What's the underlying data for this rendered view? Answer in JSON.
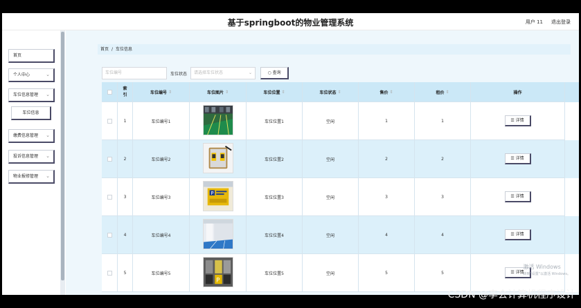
{
  "header": {
    "title": "基于springboot的物业管理系统",
    "user_label": "用户 11",
    "logout_label": "退出登录"
  },
  "sidebar": {
    "items": [
      {
        "label": "首页",
        "chevron": ""
      },
      {
        "label": "个人中心",
        "chevron": "⌄"
      },
      {
        "label": "车位信息管理",
        "chevron": "⌄"
      },
      {
        "label": "车位信息",
        "chevron": ""
      },
      {
        "label": "缴费信息管理",
        "chevron": "⌄"
      },
      {
        "label": "投诉信息管理",
        "chevron": "⌄"
      },
      {
        "label": "物业报修管理",
        "chevron": "⌄"
      }
    ]
  },
  "breadcrumb": {
    "home": "首页",
    "separator": "/",
    "current": "车位信息"
  },
  "search": {
    "number_placeholder": "车位编号",
    "status_label": "车位状态",
    "status_placeholder": "请选择车位状态",
    "query_label": "○ 查询"
  },
  "table": {
    "columns": {
      "index": "索引",
      "number": "车位编号",
      "image": "车位图片",
      "location": "车位位置",
      "status": "车位状态",
      "price": "售价",
      "rent": "租价",
      "action": "操作"
    },
    "sort_icon": "⇕",
    "detail_label": "☰ 详情",
    "rows": [
      {
        "index": "1",
        "number": "车位编号1",
        "location": "车位位置1",
        "status": "空闲",
        "price": "1",
        "rent": "1",
        "image": "parking-green-lot"
      },
      {
        "index": "2",
        "number": "车位编号2",
        "location": "车位位置2",
        "status": "空闲",
        "price": "2",
        "rent": "2",
        "image": "parking-lot-sign"
      },
      {
        "index": "3",
        "number": "车位编号3",
        "location": "车位位置3",
        "status": "空闲",
        "price": "3",
        "rent": "3",
        "image": "parking-yellow-sign"
      },
      {
        "index": "4",
        "number": "车位编号4",
        "location": "车位位置4",
        "status": "空闲",
        "price": "4",
        "rent": "4",
        "image": "parking-garage-blue"
      },
      {
        "index": "5",
        "number": "车位编号5",
        "location": "车位位置5",
        "status": "空闲",
        "price": "5",
        "rent": "5",
        "image": "parking-spaces-cars"
      }
    ]
  },
  "watermark": {
    "line1": "激活 Windows",
    "line2": "转到\"设置\"以激活 Windows。"
  },
  "overlay": {
    "csdn": "CSDN @李会计算机程序设计"
  },
  "colors": {
    "header_bg": "#ffffff",
    "content_bg": "#eef7fc",
    "table_header_bg": "#cbe8f7",
    "row_alt_bg": "#dcf0fa",
    "button_shadow": "#4a4a66"
  }
}
